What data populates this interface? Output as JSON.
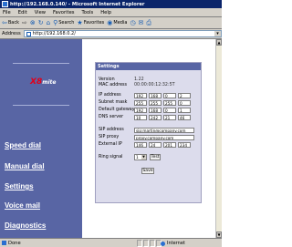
{
  "window": {
    "title": "http://192.168.0.140/ - Microsoft Internet Explorer"
  },
  "menu": [
    "File",
    "Edit",
    "View",
    "Favorites",
    "Tools",
    "Help"
  ],
  "toolbar": {
    "back": "Back",
    "forward": "→",
    "search": "Search",
    "favorites": "Favorites",
    "media": "Media"
  },
  "address": {
    "label": "Address",
    "value": "http://192.168.0.2/"
  },
  "nav": {
    "logo_x": "X8",
    "logo_mite": "mite",
    "items": [
      "Speed dial",
      "Manual dial",
      "Settings",
      "Voice mail",
      "Diagnostics"
    ]
  },
  "settings": {
    "header": "Settings",
    "version_label": "Version",
    "version_value": "1.22",
    "mac_label": "MAC address",
    "mac_value": "00:00:00:12:32:5T",
    "ip_label": "IP address",
    "ip": [
      "192",
      "168",
      "0",
      "2"
    ],
    "subnet_label": "Subnet mask",
    "subnet": [
      "255",
      "255",
      "255",
      "0"
    ],
    "gateway_label": "Default gateway",
    "gateway": [
      "192",
      "168",
      "0",
      "1"
    ],
    "dns_label": "DNS server",
    "dns": [
      "10",
      "242",
      "21",
      "46"
    ],
    "sip_address_label": "SIP address",
    "sip_address_value": "sip:martin@company.com",
    "sip_proxy_label": "SIP proxy",
    "sip_proxy_value": "proxy.company.com",
    "external_ip_label": "External IP",
    "external_ip": [
      "146",
      "24",
      "201",
      "234"
    ],
    "ring_label": "Ring signal",
    "ring_value": "1",
    "test_button": "Test",
    "save_button": "Save"
  },
  "status": {
    "text": "Done",
    "zone": "Internet"
  }
}
